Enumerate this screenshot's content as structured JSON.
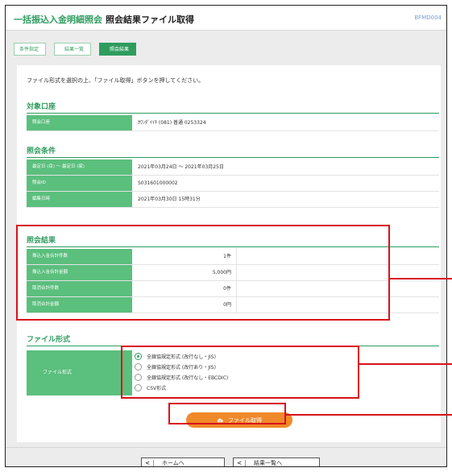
{
  "header": {
    "app_title": "一括振込入金明細照会",
    "page_title": "照会結果ファイル取得",
    "screen_id": "BFMD004"
  },
  "breadcrumb": [
    "条件指定",
    "結果一覧",
    "照会結果"
  ],
  "instruction": "ファイル形式を選択の上、「ファイル取得」ボタンを押してください。",
  "account_section": {
    "title": "対象口座",
    "rows": [
      {
        "label": "照会口座",
        "value": "ｶﾜﾝﾀﾞｲｲﾁ (081) 普通 0253324"
      }
    ]
  },
  "condition_section": {
    "title": "照会条件",
    "rows": [
      {
        "label": "最定日 (目) ～ 最定日 (家)",
        "value": "2021年03月24日 ～ 2021年03月25日"
      },
      {
        "label": "照会ID",
        "value": "S031601000002"
      },
      {
        "label": "編集日時",
        "value": "2021年03月30日 15時31分"
      }
    ]
  },
  "result_section": {
    "title": "照会結果",
    "rows": [
      {
        "label": "振込入金合計件数",
        "value": "1件"
      },
      {
        "label": "振込入金合計金額",
        "value": "5,000円"
      },
      {
        "label": "取消合計件数",
        "value": "0件"
      },
      {
        "label": "取消合計金額",
        "value": "0円"
      }
    ]
  },
  "file_section": {
    "title": "ファイル形式",
    "label": "ファイル形式",
    "options": [
      {
        "label": "全銀協規定形式 (改行なし・JIS)",
        "selected": true
      },
      {
        "label": "全銀協規定形式 (改行あり・JIS)",
        "selected": false
      },
      {
        "label": "全銀協規定形式 (改行なし・EBCDIC)",
        "selected": false
      },
      {
        "label": "CSV形式",
        "selected": false
      }
    ]
  },
  "download_button": {
    "label": "ファイル取得",
    "icon": "cloud-download-icon"
  },
  "nav": {
    "home_label": "ホームへ",
    "list_label": "結果一覧へ"
  },
  "colors": {
    "brand_green": "#2e9c5f",
    "label_green": "#5bbf7d",
    "orange": "#f0892a",
    "highlight_red": "#d8121c"
  }
}
